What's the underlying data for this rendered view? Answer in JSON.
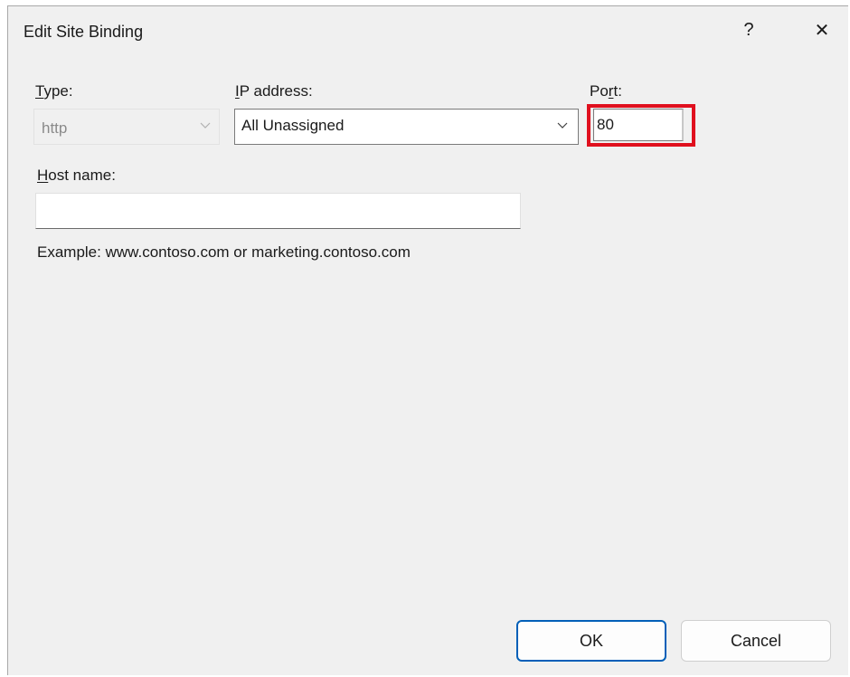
{
  "dialog": {
    "title": "Edit Site Binding",
    "help_label": "?",
    "close_label": "✕"
  },
  "type": {
    "label_accel": "T",
    "label_rest": "ype:",
    "value": "http"
  },
  "ip": {
    "label_accel": "I",
    "label_rest": "P address:",
    "value": "All Unassigned"
  },
  "port": {
    "label_pre": "Po",
    "label_accel": "r",
    "label_rest": "t:",
    "value": "80",
    "highlight_color": "#e0101e"
  },
  "host": {
    "label_accel": "H",
    "label_rest": "ost name:",
    "value": "",
    "example": "Example: www.contoso.com or marketing.contoso.com"
  },
  "buttons": {
    "ok_label": "OK",
    "cancel_label": "Cancel",
    "accent": "#005fb8"
  }
}
